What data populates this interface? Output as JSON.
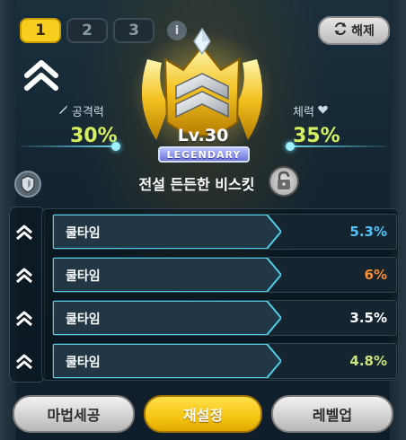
{
  "tabs": [
    {
      "label": "1",
      "active": true
    },
    {
      "label": "2",
      "active": false
    },
    {
      "label": "3",
      "active": false
    }
  ],
  "info_icon": "i",
  "unset_button": {
    "icon": "refresh-icon",
    "label": "해제"
  },
  "stats": {
    "attack": {
      "label": "공격력",
      "icon": "pen-icon",
      "value": "30%"
    },
    "health": {
      "label": "체력",
      "icon": "heart-icon",
      "value": "35%"
    }
  },
  "emblem": {
    "level": "Lv.30",
    "rarity": "LEGENDARY"
  },
  "cookie_name": "전설 든든한 비스킷",
  "options": [
    {
      "label": "쿨타임",
      "value": "5.3%",
      "value_color": "#4ec3ff"
    },
    {
      "label": "쿨타임",
      "value": "6%",
      "value_color": "#ff8c2a"
    },
    {
      "label": "쿨타임",
      "value": "3.5%",
      "value_color": "#ffffff"
    },
    {
      "label": "쿨타임",
      "value": "4.8%",
      "value_color": "#cde27a"
    }
  ],
  "buttons": {
    "magic_craft": "마법세공",
    "reset": "재설정",
    "level_up": "레벨업"
  },
  "colors": {
    "tab_active": "#f7cd1e",
    "stat_value": "#d6ef5e",
    "accent_cyan": "#4ed0e8",
    "reset_button": "#f6c512"
  }
}
